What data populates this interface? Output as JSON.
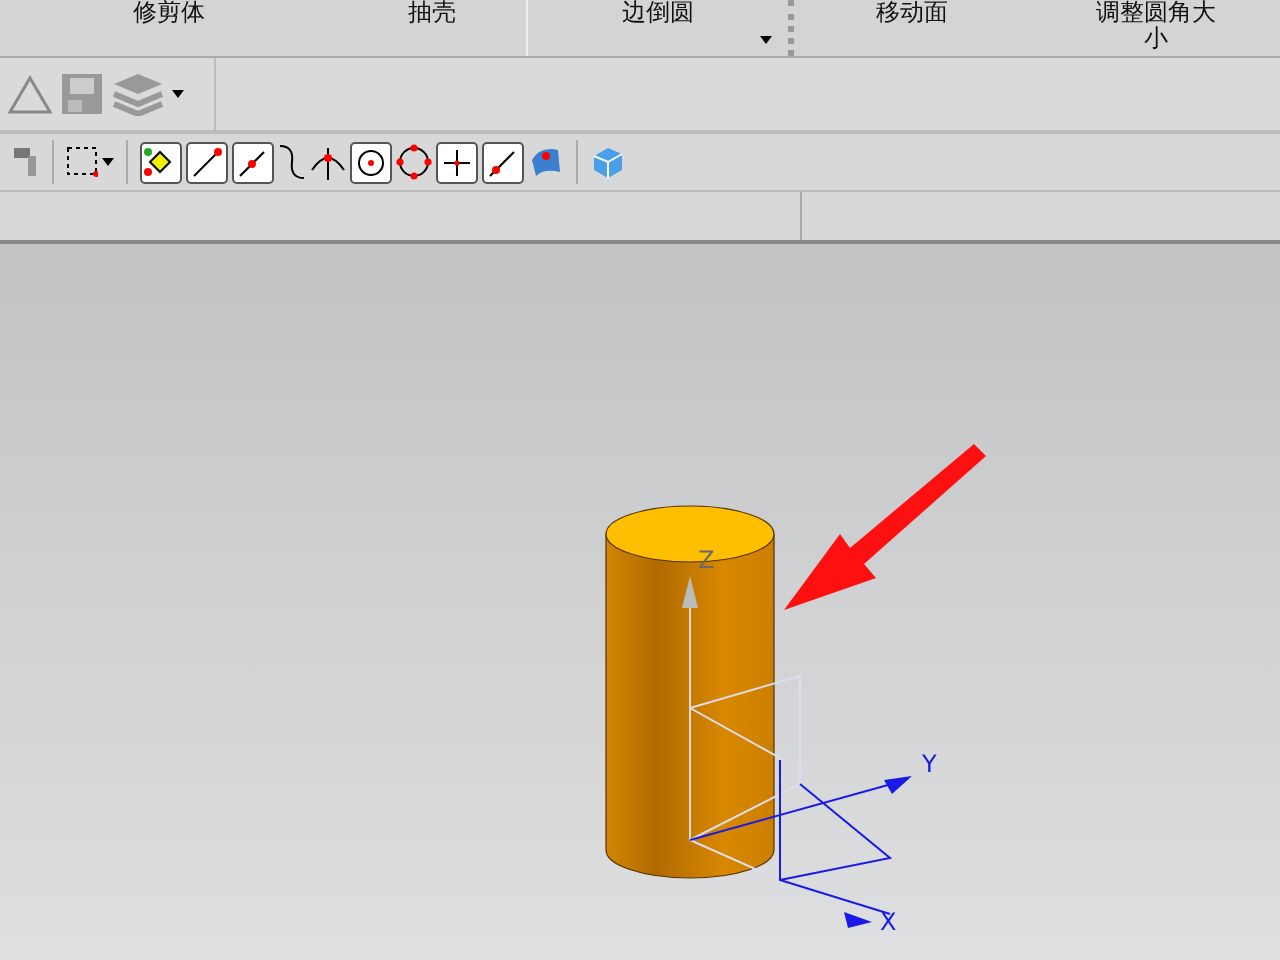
{
  "ribbon": {
    "commands": [
      {
        "label": "修剪体",
        "has_menu": false
      },
      {
        "label": "抽壳",
        "has_menu": false
      },
      {
        "label": "边倒圆",
        "has_menu": true
      },
      {
        "label": "移动面",
        "has_menu": false
      },
      {
        "label": "调整圆角大小",
        "has_menu": false
      }
    ]
  },
  "viewport": {
    "axes": [
      {
        "label": "Z"
      },
      {
        "label": "Y"
      },
      {
        "label": "X"
      }
    ]
  }
}
